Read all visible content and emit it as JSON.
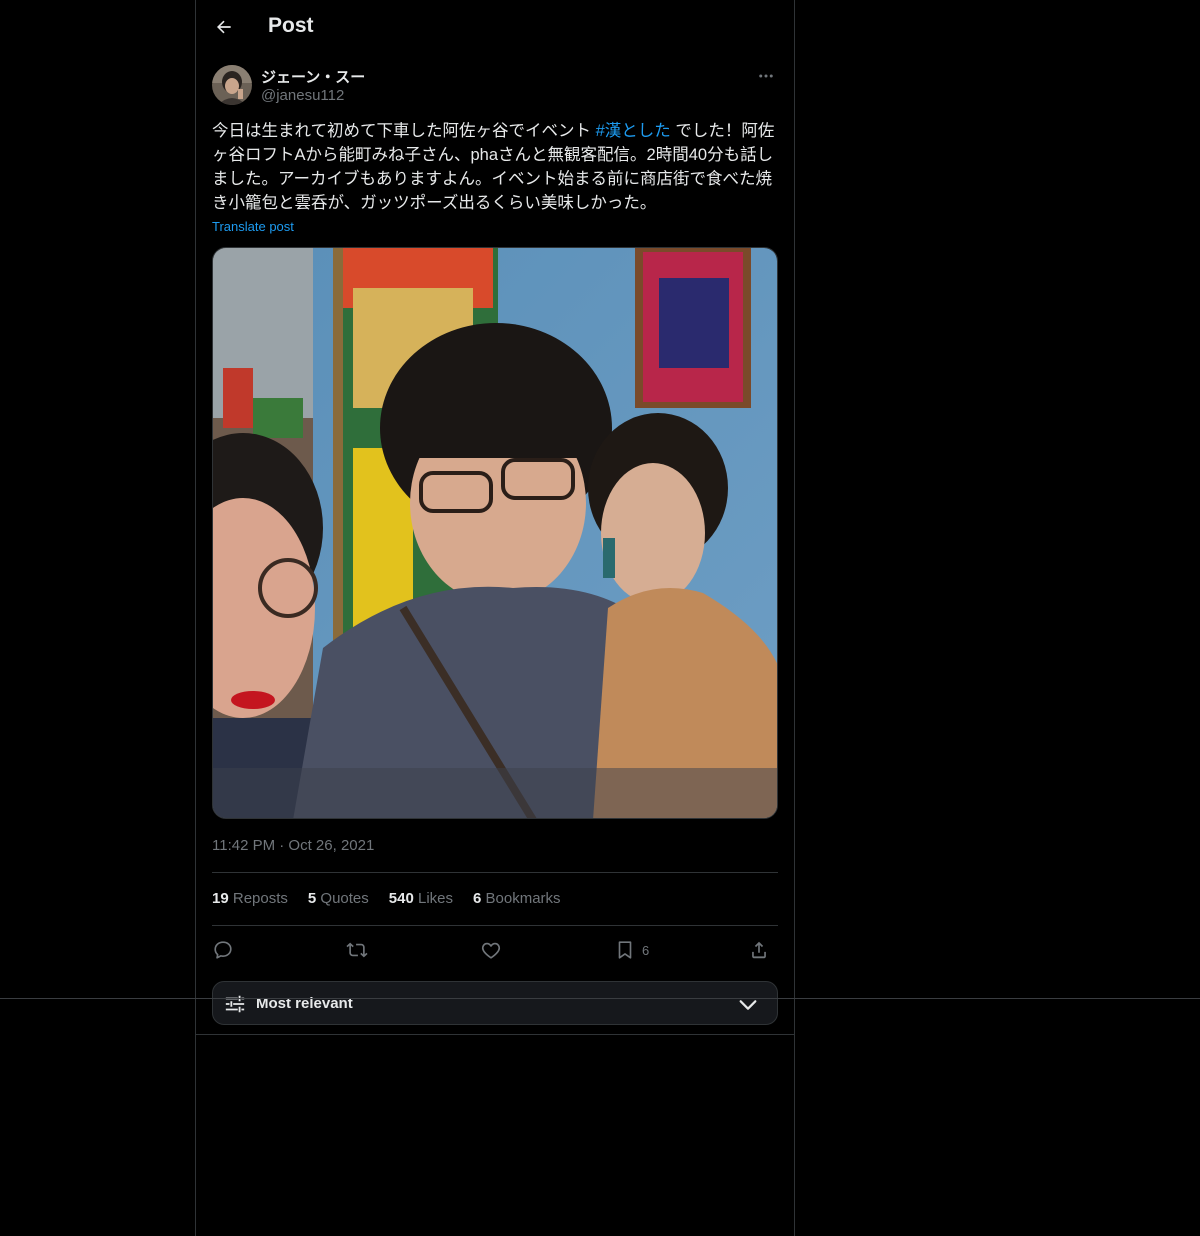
{
  "header": {
    "title": "Post",
    "back_icon": "arrow-left-icon"
  },
  "author": {
    "display_name": "ジェーン・スー",
    "handle": "@janesu112",
    "more_icon": "more-horizontal-icon"
  },
  "post": {
    "text_before": "今日は生まれて初めて下車した阿佐ヶ谷でイベント ",
    "hashtag": "#漢とした",
    "text_after": " でした！阿佐ヶ谷ロフトAから能町みね子さん、phaさんと無観客配信。2時間40分も話しました。アーカイブもありますよん。イベント始まる前に商店街で食べた焼き小籠包と雲呑が、ガッツポーズ出るくらい美味しかった。",
    "translate_label": "Translate post",
    "timestamp": "11:42 PM · Oct 26, 2021"
  },
  "stats": {
    "reposts_count": "19",
    "reposts_label": "Reposts",
    "quotes_count": "5",
    "quotes_label": "Quotes",
    "likes_count": "540",
    "likes_label": "Likes",
    "bookmarks_count": "6",
    "bookmarks_label": "Bookmarks"
  },
  "actions": {
    "reply_icon": "reply-icon",
    "repost_icon": "repost-icon",
    "like_icon": "heart-icon",
    "bookmark_icon": "bookmark-icon",
    "bookmark_count": "6",
    "share_icon": "share-icon"
  },
  "sort": {
    "label": "Most relevant",
    "icon": "sliders-icon",
    "chevron": "chevron-down-icon"
  },
  "colors": {
    "background": "#000000",
    "text": "#e7e9ea",
    "muted": "#71767b",
    "accent": "#1d9bf0",
    "border": "#2f3336"
  }
}
